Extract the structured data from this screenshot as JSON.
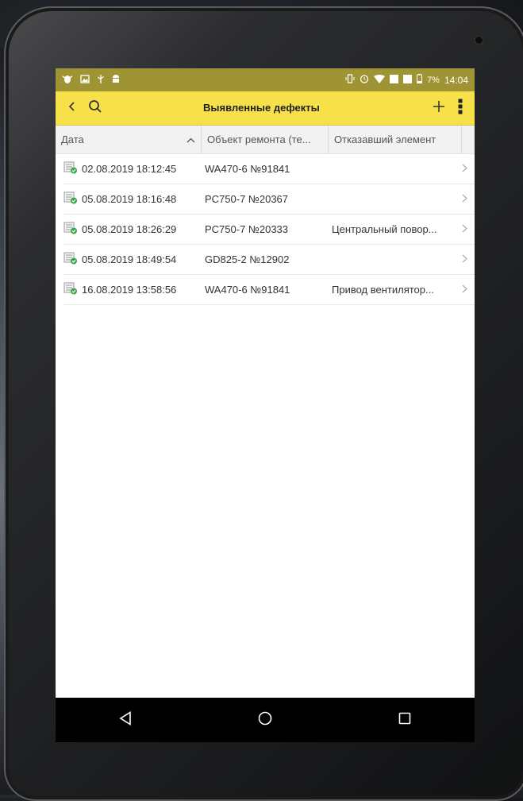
{
  "status_bar": {
    "battery": "7%",
    "time": "14:04"
  },
  "app_bar": {
    "title": "Выявленные дефекты",
    "icons": [
      "back-icon",
      "search-icon",
      "plus-icon",
      "more-vert-icon"
    ]
  },
  "table": {
    "columns": [
      "Дата",
      "Объект ремонта (те...",
      "Отказавший элемент"
    ],
    "rows": [
      {
        "date": "02.08.2019 18:12:45",
        "object": "WA470-6 №91841",
        "element": ""
      },
      {
        "date": "05.08.2019 18:16:48",
        "object": "PC750-7 №20367",
        "element": ""
      },
      {
        "date": "05.08.2019 18:26:29",
        "object": "PC750-7 №20333",
        "element": "Центральный повор..."
      },
      {
        "date": "05.08.2019 18:49:54",
        "object": "GD825-2 №12902",
        "element": ""
      },
      {
        "date": "16.08.2019 13:58:56",
        "object": "WA470-6 №91841",
        "element": "Привод вентилятор..."
      }
    ]
  },
  "colors": {
    "status_bar": "#9f9433",
    "app_bar": "#f7e04a",
    "navbar": "#000000"
  }
}
